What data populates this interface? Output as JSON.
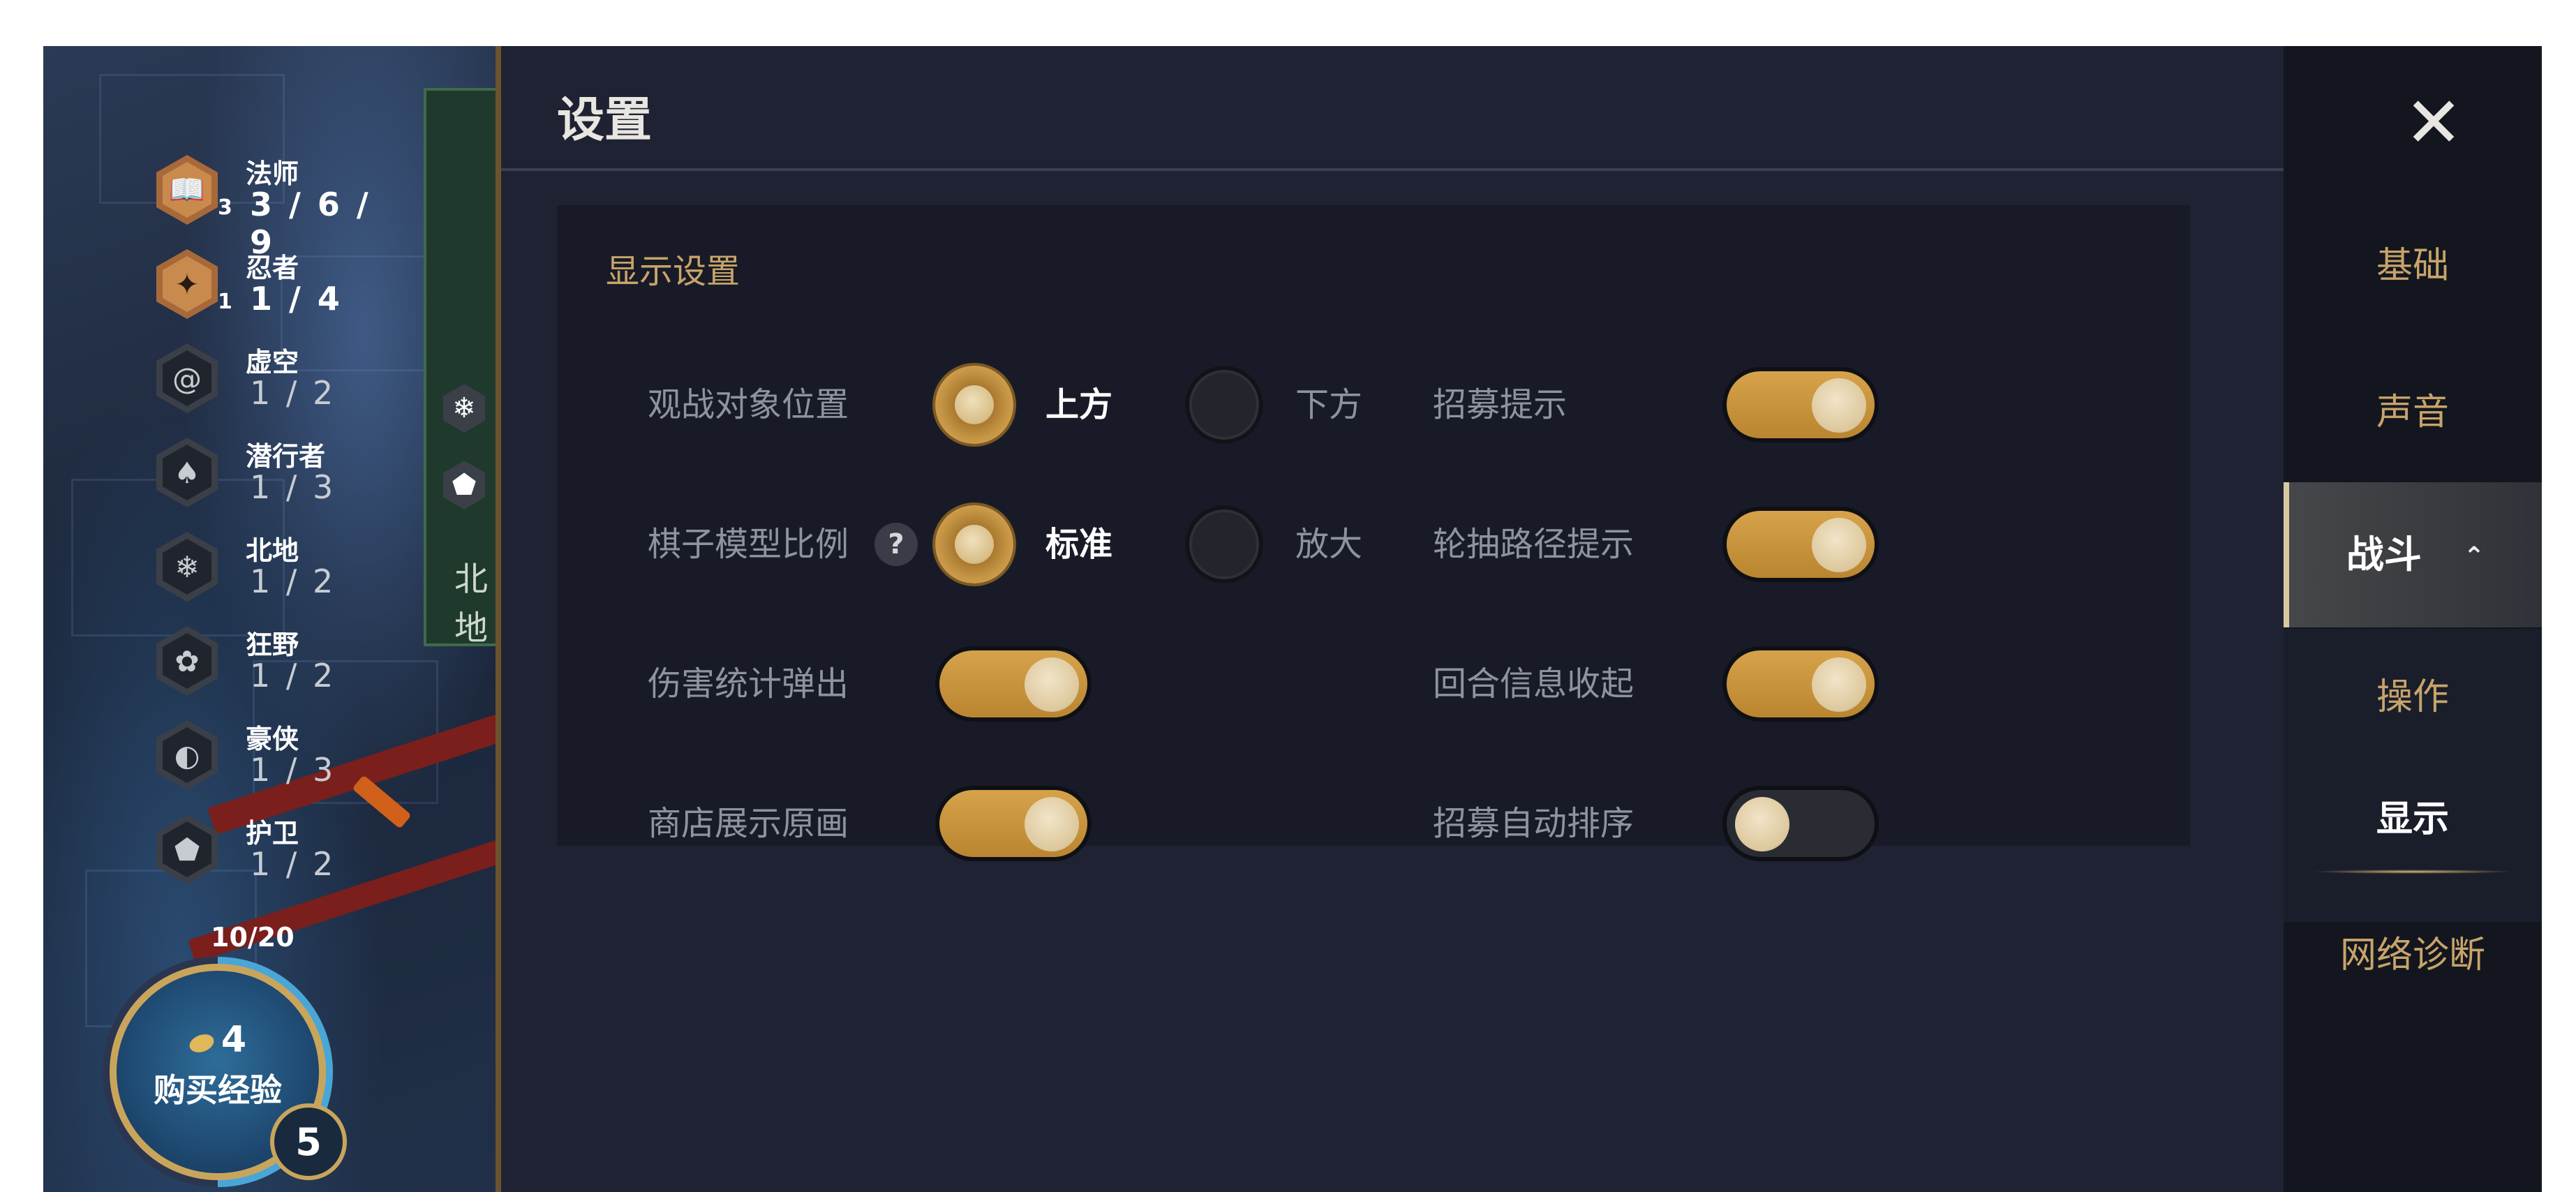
{
  "game": {
    "traits": [
      {
        "name": "法师",
        "count": "3",
        "ratio": "3 / 6 / 9",
        "icon": "book-icon",
        "glyph": "📖",
        "active": true
      },
      {
        "name": "忍者",
        "count": "1",
        "ratio": "1 / 4",
        "icon": "shuriken-icon",
        "glyph": "✦",
        "active": true
      },
      {
        "name": "虚空",
        "count": "",
        "ratio": "1 / 2",
        "icon": "spiral-icon",
        "glyph": "@",
        "active": false
      },
      {
        "name": "潜行者",
        "count": "",
        "ratio": "1 / 3",
        "icon": "hood-icon",
        "glyph": "♠",
        "active": false
      },
      {
        "name": "北地",
        "count": "",
        "ratio": "1 / 2",
        "icon": "snowflake-icon",
        "glyph": "❄",
        "active": false
      },
      {
        "name": "狂野",
        "count": "",
        "ratio": "1 / 2",
        "icon": "paw-icon",
        "glyph": "✿",
        "active": false
      },
      {
        "name": "豪侠",
        "count": "",
        "ratio": "1 / 3",
        "icon": "hat-icon",
        "glyph": "◐",
        "active": false
      },
      {
        "name": "护卫",
        "count": "",
        "ratio": "1 / 2",
        "icon": "shield-icon",
        "glyph": "⬟",
        "active": false
      }
    ],
    "xp_progress": "10/20",
    "xp_cost": "4",
    "buy_xp_label": "购买经验",
    "level": "5",
    "side_text": "北地"
  },
  "settings": {
    "title": "设置",
    "section_title": "显示设置",
    "rows": [
      {
        "label": "观战对象位置",
        "type": "radio",
        "options": [
          "上方",
          "下方"
        ],
        "selected": 0,
        "help": false
      },
      {
        "label": "棋子模型比例",
        "type": "radio",
        "options": [
          "标准",
          "放大"
        ],
        "selected": 0,
        "help": true,
        "help_text": "?"
      },
      {
        "label": "伤害统计弹出",
        "type": "toggle",
        "on": true
      },
      {
        "label": "商店展示原画",
        "type": "toggle",
        "on": true
      }
    ],
    "right_rows": [
      {
        "label": "招募提示",
        "on": true
      },
      {
        "label": "轮抽路径提示",
        "on": true
      },
      {
        "label": "回合信息收起",
        "on": true
      },
      {
        "label": "招募自动排序",
        "on": false
      }
    ]
  },
  "nav": {
    "close_icon": "close-icon",
    "items": [
      "基础",
      "声音"
    ],
    "active": "战斗",
    "sub_items": [
      "操作",
      "显示"
    ],
    "sub_active": "显示",
    "last": "网络诊断"
  },
  "colors": {
    "accent_gold": "#c8a46a",
    "toggle_on": "#d6a24a",
    "panel_bg": "#1e2232"
  }
}
